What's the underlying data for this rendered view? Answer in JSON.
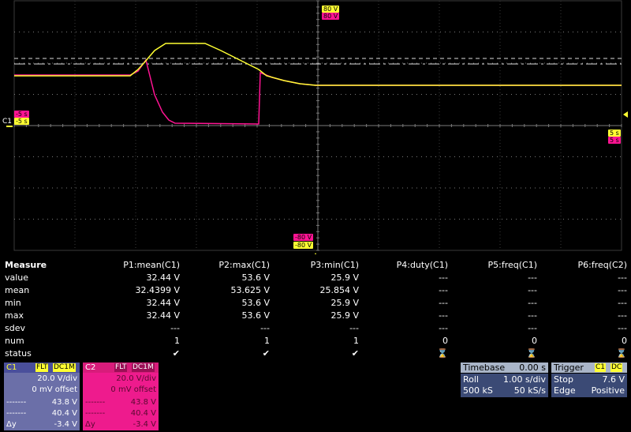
{
  "grid": {
    "line_color": "#3a3a3a",
    "dot_color": "#7a7a7a"
  },
  "scope": {
    "top_level_tags": [
      "80 V",
      "80 V"
    ],
    "bottom_level_tags": [
      "-80 V",
      "-80 V"
    ],
    "left_time_tags": [
      "-5 s",
      "-5 s"
    ],
    "right_time_tags": [
      "5 s",
      "5 s"
    ],
    "c1_label": "C1",
    "colors": {
      "c1": "#ffff32",
      "c2": "#ff1493"
    }
  },
  "measure": {
    "header_label": "Measure",
    "columns": [
      "P1:mean(C1)",
      "P2:max(C1)",
      "P3:min(C1)",
      "P4:duty(C1)",
      "P5:freq(C1)",
      "P6:freq(C2)"
    ],
    "rows": [
      {
        "label": "value",
        "cells": [
          "32.44 V",
          "53.6 V",
          "25.9 V",
          "---",
          "---",
          "---"
        ]
      },
      {
        "label": "mean",
        "cells": [
          "32.4399 V",
          "53.625 V",
          "25.854 V",
          "---",
          "---",
          "---"
        ]
      },
      {
        "label": "min",
        "cells": [
          "32.44 V",
          "53.6 V",
          "25.9 V",
          "---",
          "---",
          "---"
        ]
      },
      {
        "label": "max",
        "cells": [
          "32.44 V",
          "53.6 V",
          "25.9 V",
          "---",
          "---",
          "---"
        ]
      },
      {
        "label": "sdev",
        "cells": [
          "---",
          "---",
          "---",
          "---",
          "---",
          "---"
        ]
      },
      {
        "label": "num",
        "cells": [
          "1",
          "1",
          "1",
          "0",
          "0",
          "0"
        ]
      },
      {
        "label": "status",
        "cells": [
          "✔",
          "✔",
          "✔",
          "⌛",
          "⌛",
          "⌛"
        ]
      }
    ]
  },
  "c1": {
    "name": "C1",
    "badge1": "FLT",
    "badge2": "DC1M",
    "vdiv": "20.0 V/div",
    "offset": "0 mV offset",
    "cursor1_label": "-------",
    "cursor1": "43.8 V",
    "cursor2_label": "-------",
    "cursor2": "40.4 V",
    "dy_label": "Δy",
    "dy": "-3.4 V"
  },
  "c2": {
    "name": "C2",
    "badge1": "FLT",
    "badge2": "DC1M",
    "vdiv": "20.0 V/div",
    "offset": "0 mV offset",
    "cursor1_label": "-------",
    "cursor1": "43.8 V",
    "cursor2_label": "-------",
    "cursor2": "40.4 V",
    "dy_label": "Δy",
    "dy": "-3.4 V"
  },
  "timebase": {
    "title": "Timebase",
    "delay": "0.00 s",
    "mode": "Roll",
    "tdiv": "1.00 s/div",
    "samples": "500 kS",
    "rate": "50 kS/s"
  },
  "trigger": {
    "title": "Trigger",
    "badge1": "C1",
    "badge2": "DC",
    "mode": "Stop",
    "level": "7.6 V",
    "type": "Edge",
    "slope": "Positive"
  }
}
